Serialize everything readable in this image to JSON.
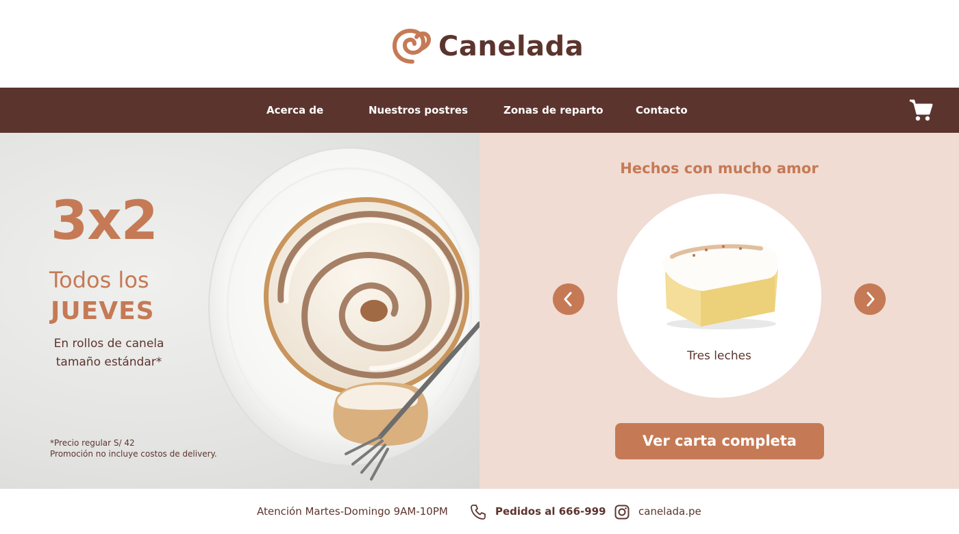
{
  "brand": {
    "name": "Canelada"
  },
  "nav": {
    "items": [
      {
        "label": "Acerca de"
      },
      {
        "label": "Nuestros postres"
      },
      {
        "label": "Zonas de reparto"
      },
      {
        "label": "Contacto"
      }
    ],
    "cart_icon": "shopping-cart-icon"
  },
  "promo": {
    "headline": "3x2",
    "line1": "Todos los",
    "line2": "JUEVES",
    "subtitle": "En rollos de canela tamaño estándar*",
    "note1": "*Precio regular S/ 42",
    "note2": "Promoción no incluye costos de delivery."
  },
  "carousel": {
    "title": "Hechos con mucho amor",
    "current_item": "Tres leches",
    "prev_icon": "chevron-left-icon",
    "next_icon": "chevron-right-icon",
    "cta_label": "Ver carta completa"
  },
  "footer": {
    "hours": "Atención Martes-Domingo 9AM-10PM",
    "phone_label": "Pedidos al 666-999",
    "instagram": "canelada.pe"
  },
  "colors": {
    "primary_brown": "#5c342e",
    "accent_terracotta": "#c57a55",
    "panel_pink": "#f0dcd3"
  }
}
